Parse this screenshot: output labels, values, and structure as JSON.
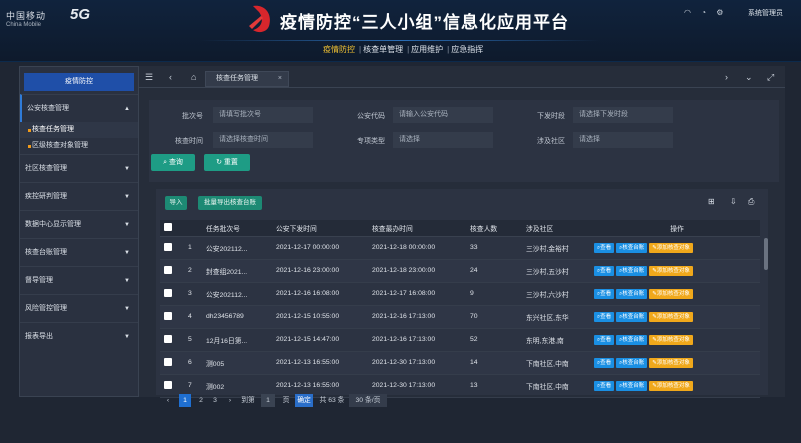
{
  "brand": {
    "cm": "中国移动",
    "cm_en": "China Mobile",
    "fiveg": "5G"
  },
  "title": "疫情防控“三人小组”信息化应用平台",
  "topnav": [
    "疫情防控",
    "核查单管理",
    "应用维护",
    "应急指挥"
  ],
  "topnav_sep": "|",
  "user": "系统管理员",
  "icons": {
    "wifi": "📶",
    "bell": "🔔",
    "settings": "⚙"
  },
  "sidebar": {
    "header": "疫情防控",
    "groups": [
      {
        "label": "公安核查管理",
        "open": true,
        "children": [
          "核查任务管理",
          "区级核查对象管理"
        ]
      },
      {
        "label": "社区核查管理"
      },
      {
        "label": "疾控研判管理"
      },
      {
        "label": "数据中心显示管理"
      },
      {
        "label": "核查台账管理"
      },
      {
        "label": "督导管理"
      },
      {
        "label": "风险管控管理"
      },
      {
        "label": "报表导出"
      }
    ]
  },
  "tab": {
    "label": "核查任务管理",
    "close": "×"
  },
  "filters": {
    "batch_label": "批次号",
    "batch_ph": "请填写批次号",
    "police_label": "公安代码",
    "police_ph": "请输入公安代码",
    "issue_label": "下发时段",
    "issue_ph": "请选择下发时段",
    "check_label": "核查时间",
    "check_ph": "请选择核查时间",
    "type_label": "专项类型",
    "type_ph": "请选择",
    "community_label": "涉及社区",
    "community_ph": "请选择",
    "query": "查询",
    "reset": "重置"
  },
  "toolbar": {
    "import": "导入",
    "batch_export": "批量导出核查台账"
  },
  "table": {
    "headers": [
      "",
      "",
      "任务批次号",
      "公安下发时间",
      "核查最办时间",
      "核查人数",
      "涉及社区",
      "操作"
    ],
    "rows": [
      {
        "n": "1",
        "batch": "公安202112...",
        "issued": "2021-12-17 00:00:00",
        "deadline": "2021-12-18 00:00:00",
        "count": "33",
        "community": "三沙村,金裕村"
      },
      {
        "n": "2",
        "batch": "封查组2021...",
        "issued": "2021-12-16 23:00:00",
        "deadline": "2021-12-18 23:00:00",
        "count": "24",
        "community": "三沙村,五沙村"
      },
      {
        "n": "3",
        "batch": "公安202112...",
        "issued": "2021-12-16 16:08:00",
        "deadline": "2021-12-17 16:08:00",
        "count": "9",
        "community": "三沙村,六沙村"
      },
      {
        "n": "4",
        "batch": "dh23456789",
        "issued": "2021-12-15 10:55:00",
        "deadline": "2021-12-16 17:13:00",
        "count": "70",
        "community": "东兴社区,东华"
      },
      {
        "n": "5",
        "batch": "12月16日第...",
        "issued": "2021-12-15 14:47:00",
        "deadline": "2021-12-16 17:13:00",
        "count": "52",
        "community": "东明,东港,南"
      },
      {
        "n": "6",
        "batch": "测005",
        "issued": "2021-12-13 16:55:00",
        "deadline": "2021-12-30 17:13:00",
        "count": "14",
        "community": "下南社区,中南"
      },
      {
        "n": "7",
        "batch": "测002",
        "issued": "2021-12-13 16:55:00",
        "deadline": "2021-12-30 17:13:00",
        "count": "13",
        "community": "下南社区,中南"
      }
    ],
    "ops": [
      "查看",
      "核查台账",
      "添加核查对象"
    ]
  },
  "pager": {
    "prev": "‹",
    "pages": [
      "1",
      "2",
      "3"
    ],
    "next": "›",
    "goto_label": "到第",
    "goto_value": "1",
    "page_unit": "页",
    "confirm": "确定",
    "total": "共 63 条",
    "size": "30 条/页"
  },
  "colors": {
    "accent": "#1f4fa8",
    "teal": "#1e9c85",
    "op_blue": "#1a8fe3",
    "op_yellow": "#f0a81b",
    "nav_active": "#f1c232"
  }
}
